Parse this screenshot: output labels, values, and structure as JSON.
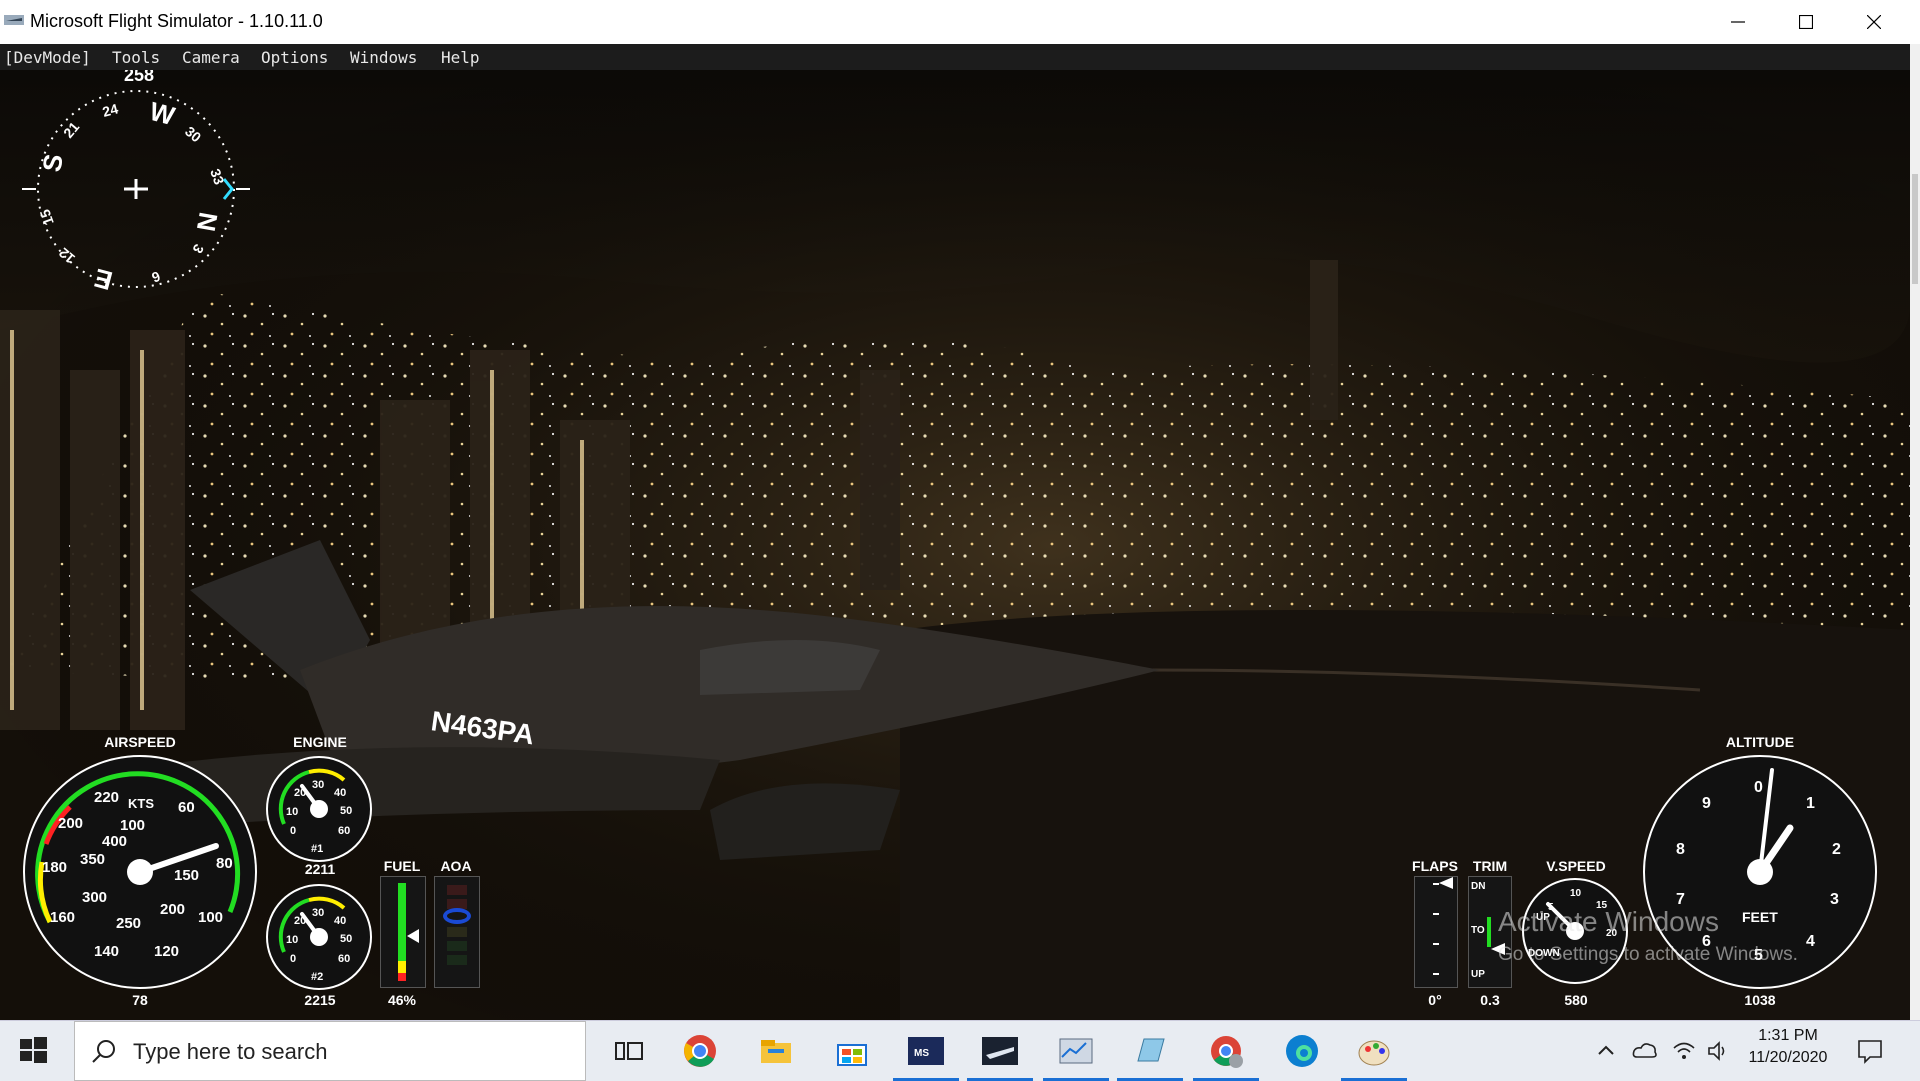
{
  "window": {
    "title": "Microsoft Flight Simulator - 1.10.11.0"
  },
  "menu": {
    "items": [
      "[DevMode]",
      "Tools",
      "Camera",
      "Options",
      "Windows",
      "Help"
    ]
  },
  "compass": {
    "heading": "258",
    "cardinals": [
      "N",
      "E",
      "S",
      "W"
    ],
    "ticks": [
      "24",
      "21",
      "15",
      "12",
      "6",
      "3",
      "33",
      "30"
    ]
  },
  "aircraft": {
    "registration": "N463PA"
  },
  "instruments": {
    "airspeed": {
      "label": "AIRSPEED",
      "unit": "KTS",
      "value": "78",
      "outer_marks": [
        "60",
        "80",
        "100",
        "120",
        "140",
        "160",
        "180",
        "200",
        "220"
      ],
      "inner_marks": [
        "100",
        "150",
        "200",
        "250",
        "300",
        "350",
        "400"
      ]
    },
    "engine": {
      "label": "ENGINE",
      "gauge1": {
        "name": "#1",
        "value": "2211",
        "marks": [
          "0",
          "10",
          "20",
          "30",
          "40",
          "50",
          "60"
        ]
      },
      "gauge2": {
        "name": "#2",
        "value": "2215",
        "marks": [
          "0",
          "10",
          "20",
          "30",
          "40",
          "50",
          "60"
        ]
      }
    },
    "fuel": {
      "label": "FUEL",
      "value": "46%",
      "fraction": 0.46
    },
    "aoa": {
      "label": "AOA"
    },
    "flaps": {
      "label": "FLAPS",
      "value": "0°"
    },
    "trim": {
      "label": "TRIM",
      "value": "0.3",
      "marks": [
        "DN",
        "TO",
        "UP"
      ]
    },
    "vspeed": {
      "label": "V.SPEED",
      "value": "580",
      "marks": [
        "UP",
        "DOWN",
        "5",
        "10",
        "15",
        "20"
      ]
    },
    "altitude": {
      "label": "ALTITUDE",
      "unit": "FEET",
      "value": "1038",
      "marks": [
        "0",
        "1",
        "2",
        "3",
        "4",
        "5",
        "6",
        "7",
        "8",
        "9"
      ]
    }
  },
  "watermark": {
    "line1": "Activate Windows",
    "line2": "Go to Settings to activate Windows."
  },
  "taskbar": {
    "search_placeholder": "Type here to search",
    "time": "1:31 PM",
    "date": "11/20/2020"
  },
  "colors": {
    "accent": "#1a6fd4",
    "gauge_green": "#22dd22",
    "gauge_yellow": "#ffee00",
    "gauge_red": "#ff2222"
  }
}
